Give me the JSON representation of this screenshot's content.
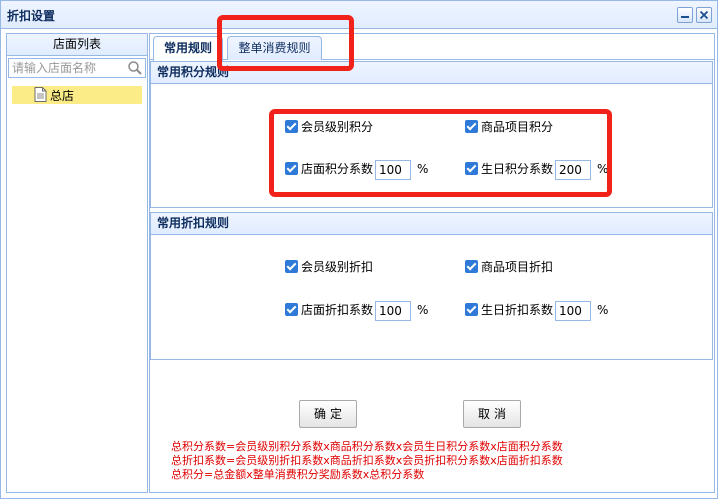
{
  "window": {
    "title": "折扣设置"
  },
  "store_panel": {
    "header": "店面列表",
    "search_placeholder": "请输入店面名称",
    "stores": [
      {
        "label": "总店",
        "selected": true
      }
    ]
  },
  "tabs": [
    {
      "label": "常用规则",
      "active": true
    },
    {
      "label": "整单消费规则",
      "active": false
    }
  ],
  "points_rules": {
    "header": "常用积分规则",
    "member_level": {
      "label": "会员级别积分",
      "checked": true
    },
    "product_item": {
      "label": "商品项目积分",
      "checked": true
    },
    "store_coef": {
      "label": "店面积分系数",
      "value": "100",
      "unit": "%",
      "checked": true
    },
    "birthday_coef": {
      "label": "生日积分系数",
      "value": "200",
      "unit": "%",
      "checked": true
    }
  },
  "discount_rules": {
    "header": "常用折扣规则",
    "member_level": {
      "label": "会员级别折扣",
      "checked": true
    },
    "product_item": {
      "label": "商品项目折扣",
      "checked": true
    },
    "store_coef": {
      "label": "店面折扣系数",
      "value": "100",
      "unit": "%",
      "checked": true
    },
    "birthday_coef": {
      "label": "生日折扣系数",
      "value": "100",
      "unit": "%",
      "checked": true
    }
  },
  "buttons": {
    "ok": "确定",
    "cancel": "取消"
  },
  "formulas": [
    "总积分系数=会员级别积分系数x商品积分系数x会员生日积分系数x店面积分系数",
    "总折扣系数=会员级别折扣系数x商品折扣系数x会员折扣积分系数x店面折扣系数",
    "总积分=总金额x整单消费积分奖励系数x总积分系数"
  ],
  "colors": {
    "border": "#95b8e7",
    "header_gradient_top": "#eff5ff",
    "header_gradient_bottom": "#e0ecff",
    "selected_node": "#fbec88",
    "checkbox": "#2f7ad8",
    "highlight": "#f0221a",
    "formula_text": "#e00000"
  },
  "icons": [
    "minimize-icon",
    "close-icon",
    "search-icon",
    "file-icon",
    "checkbox-checked-icon"
  ]
}
